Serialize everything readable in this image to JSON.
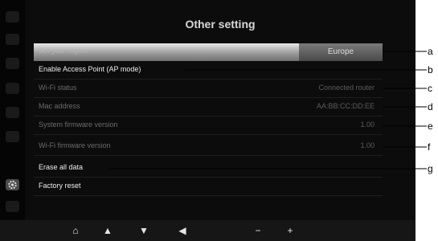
{
  "screen": {
    "title": "Other setting",
    "rows": [
      {
        "label": "Set your region",
        "value": "Europe"
      },
      {
        "label": "Enable Access Point (AP mode)",
        "value": ""
      },
      {
        "label": "Wi-Fi status",
        "value": "Connected router"
      },
      {
        "label": "Mac address",
        "value": "AA:BB:CC:DD:EE"
      },
      {
        "label": "System firmware version",
        "value": "1.00"
      },
      {
        "label": "Wi-Fi firmware version",
        "value": "1.00"
      },
      {
        "label": "Erase all data",
        "value": ""
      },
      {
        "label": "Factory reset",
        "value": ""
      }
    ]
  },
  "bottom_bar": {
    "home": "⌂",
    "up": "▲",
    "down": "▼",
    "back": "◀",
    "minus": "−",
    "plus": "+"
  },
  "callouts": [
    "a",
    "b",
    "c",
    "d",
    "e",
    "f",
    "g"
  ],
  "icons": {
    "sidebar": [
      "clock-icon",
      "alarm-icon",
      "radio-icon",
      "music-icon",
      "equalizer-icon",
      "sleep-icon",
      "settings-icon",
      "wifi-icon"
    ]
  }
}
